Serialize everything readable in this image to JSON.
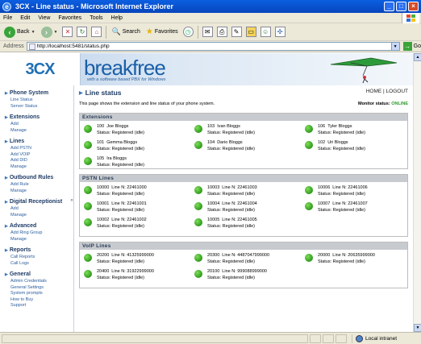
{
  "window": {
    "title": "3CX - Line status - Microsoft Internet Explorer",
    "buttons": [
      "_",
      "□",
      "×"
    ]
  },
  "menu": [
    "File",
    "Edit",
    "View",
    "Favorites",
    "Tools",
    "Help"
  ],
  "toolbar": {
    "back": "Back",
    "search": "Search",
    "favorites": "Favorites",
    "icons": [
      "back-icon",
      "forward-icon",
      "stop-icon",
      "refresh-icon",
      "home-icon",
      "search-icon",
      "favorites-icon",
      "history-icon",
      "mail-icon",
      "print-icon",
      "folder-icon",
      "messenger-icon"
    ]
  },
  "address": {
    "label": "Address",
    "url": "http://localhost:5481/status.php",
    "go": "Go"
  },
  "banner": {
    "logo": "3CX",
    "brand": "breakfree",
    "tagline": "with a software based PBX for Windows"
  },
  "sidebar": [
    {
      "title": "Phone System",
      "links": [
        "Line Status",
        "Server Status"
      ]
    },
    {
      "title": "Extensions",
      "links": [
        "Add",
        "Manage"
      ]
    },
    {
      "title": "Lines",
      "links": [
        "Add PSTN",
        "Add VOIP",
        "Add DID",
        "Manage"
      ]
    },
    {
      "title": "Outbound Rules",
      "links": [
        "Add Rule",
        "Manage"
      ]
    },
    {
      "title": "Digital Receptionist",
      "links": [
        "Add",
        "Manage"
      ]
    },
    {
      "title": "Advanced",
      "links": [
        "Add Ring Group",
        "Manage"
      ]
    },
    {
      "title": "Reports",
      "links": [
        "Call Reports",
        "Call Logs"
      ]
    },
    {
      "title": "General",
      "links": [
        "Admin Credentials",
        "General Settings",
        "System prompts",
        "How to Buy",
        "Support"
      ]
    }
  ],
  "main": {
    "title": "Line status",
    "home": "HOME",
    "sep": "|",
    "logout": "LOGOUT",
    "description": "This page shows the extension and line status of your phone system.",
    "monitor_label": "Monitor status:",
    "monitor_value": "ONLINE"
  },
  "groups": [
    {
      "title": "Extensions",
      "items": [
        {
          "num": "100",
          "name": "Joe Bloggs",
          "status": "Status: Registered (idle)"
        },
        {
          "num": "103",
          "name": "Ivan Bloggs",
          "status": "Status: Registered (idle)"
        },
        {
          "num": "106",
          "name": "Tyler Bloggs",
          "status": "Status: Registered (idle)"
        },
        {
          "num": "101",
          "name": "Gemma Bloggs",
          "status": "Status: Registered (idle)"
        },
        {
          "num": "104",
          "name": "Dario Bloggs",
          "status": "Status: Registered (idle)"
        },
        {
          "num": "102",
          "name": "Uri Bloggs",
          "status": "Status: Registered (idle)"
        },
        {
          "num": "105",
          "name": "Ira Bloggs",
          "status": "Status: Registered (idle)"
        }
      ]
    },
    {
      "title": "PSTN Lines",
      "items": [
        {
          "num": "10000",
          "name": "Line N: 22461000",
          "status": "Status: Registered (idle)"
        },
        {
          "num": "10003",
          "name": "Line N: 22461003",
          "status": "Status: Registered (idle)"
        },
        {
          "num": "10006",
          "name": "Line N: 22461006",
          "status": "Status: Registered (idle)"
        },
        {
          "num": "10001",
          "name": "Line N: 22461001",
          "status": "Status: Registered (idle)"
        },
        {
          "num": "10004",
          "name": "Line N: 22461004",
          "status": "Status: Registered (idle)"
        },
        {
          "num": "10007",
          "name": "Line N: 22461007",
          "status": "Status: Registered (idle)"
        },
        {
          "num": "10002",
          "name": "Line N: 22461002",
          "status": "Status: Registered (idle)"
        },
        {
          "num": "10005",
          "name": "Line N: 22461005",
          "status": "Status: Registered (idle)"
        }
      ]
    },
    {
      "title": "VoIP Lines",
      "items": [
        {
          "num": "20200",
          "name": "Line N: 41325999000",
          "status": "Status: Registered (idle)"
        },
        {
          "num": "20300",
          "name": "Line N: 4487047999000",
          "status": "Status: Registered (idle)"
        },
        {
          "num": "20000",
          "name": "Line N: 20635999000",
          "status": "Status: Registered (idle)"
        },
        {
          "num": "20400",
          "name": "Line N: 31922999000",
          "status": "Status: Registered (idle)"
        },
        {
          "num": "20100",
          "name": "Line N: 999088999000",
          "status": "Status: Registered (idle)"
        }
      ]
    }
  ],
  "statusbar": {
    "zone": "Local intranet"
  }
}
